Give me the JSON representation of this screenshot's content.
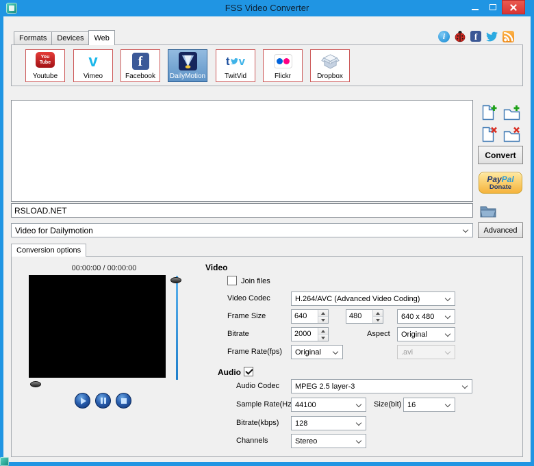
{
  "window": {
    "title": "FSS Video Converter"
  },
  "tabs": [
    {
      "label": "Formats"
    },
    {
      "label": "Devices"
    },
    {
      "label": "Web"
    }
  ],
  "services": [
    {
      "label": "Youtube"
    },
    {
      "label": "Vimeo"
    },
    {
      "label": "Facebook"
    },
    {
      "label": "DailyMotion"
    },
    {
      "label": "TwitVid"
    },
    {
      "label": "Flickr"
    },
    {
      "label": "Dropbox"
    }
  ],
  "icon_text": {
    "youtube_line1": "You",
    "youtube_line2": "Tube",
    "vimeo": "v",
    "facebook": "f",
    "twitvid_t": "t",
    "twitvid_v": "v",
    "info": "i"
  },
  "actions": {
    "convert": "Convert",
    "advanced": "Advanced",
    "paypal_pay": "Pay",
    "paypal_pal": "Pal",
    "paypal_donate": "Donate"
  },
  "output": {
    "filename": "RSLOAD.NET",
    "profile": "Video for Dailymotion"
  },
  "conversion": {
    "tab_label": "Conversion options",
    "preview_time": "00:00:00  /  00:00:00"
  },
  "video": {
    "header": "Video",
    "join_files_label": "Join files",
    "codec_label": "Video Codec",
    "codec_value": "H.264/AVC (Advanced Video Coding)",
    "frame_size_label": "Frame Size",
    "frame_width": "640",
    "frame_height": "480",
    "frame_preset": "640 x 480",
    "bitrate_label": "Bitrate",
    "bitrate_value": "2000",
    "aspect_label": "Aspect",
    "aspect_value": "Original",
    "frame_rate_label": "Frame Rate(fps)",
    "frame_rate_value": "Original",
    "container_value": ".avi"
  },
  "audio": {
    "header": "Audio",
    "codec_label": "Audio Codec",
    "codec_value": "MPEG 2.5 layer-3",
    "sample_rate_label": "Sample Rate(Hz)",
    "sample_rate_value": "44100",
    "size_bit_label": "Size(bit)",
    "size_bit_value": "16",
    "bitrate_label": "Bitrate(kbps)",
    "bitrate_value": "128",
    "channels_label": "Channels",
    "channels_value": "Stereo"
  },
  "colors": {
    "titlebar_blue": "#2095e3",
    "selected_service_blue": "#5f94c7",
    "close_red": "#d93535",
    "paypal_gold": "#f5b33c",
    "youtube_red": "#cc181e",
    "vimeo_blue": "#1ab7ea",
    "facebook_blue": "#3b5998",
    "flickr_blue": "#0063dc",
    "flickr_pink": "#ff0084"
  }
}
